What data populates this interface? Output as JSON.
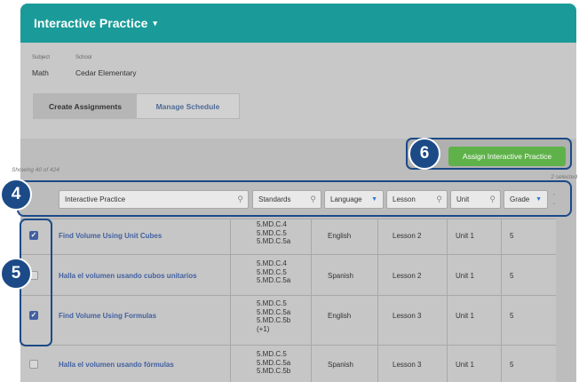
{
  "header": {
    "title": "Interactive Practice",
    "caret": "▾"
  },
  "meta": {
    "subject_label": "Subject",
    "subject_value": "Math",
    "school_label": "School",
    "school_value": "Cedar Elementary"
  },
  "tabs": [
    {
      "label": "Create Assignments",
      "active": true
    },
    {
      "label": "Manage Schedule",
      "active": false
    }
  ],
  "toolbar": {
    "showing": "Showing 40 of 424",
    "selected": "2 selected",
    "assign_label": "Assign Interactive Practice"
  },
  "filters": {
    "title_placeholder": "Interactive Practice",
    "standards": "Standards",
    "language": "Language",
    "lesson": "Lesson",
    "unit": "Unit",
    "grade": "Grade"
  },
  "callouts": {
    "four": "4",
    "five": "5",
    "six": "6"
  },
  "rows": [
    {
      "checked": true,
      "title": "Find Volume Using Unit Cubes",
      "standards": [
        "5.MD.C.4",
        "5.MD.C.5",
        "5.MD.C.5a"
      ],
      "language": "English",
      "lesson": "Lesson 2",
      "unit": "Unit 1",
      "grade": "5"
    },
    {
      "checked": false,
      "title": "Halla el volumen usando cubos unitarios",
      "standards": [
        "5.MD.C.4",
        "5.MD.C.5",
        "5.MD.C.5a"
      ],
      "language": "Spanish",
      "lesson": "Lesson 2",
      "unit": "Unit 1",
      "grade": "5"
    },
    {
      "checked": true,
      "title": "Find Volume Using Formulas",
      "standards": [
        "5.MD.C.5",
        "5.MD.C.5a",
        "5.MD.C.5b",
        "(+1)"
      ],
      "language": "English",
      "lesson": "Lesson 3",
      "unit": "Unit 1",
      "grade": "5"
    },
    {
      "checked": false,
      "title": "Halla el volumen usando fórmulas",
      "standards": [
        "5.MD.C.5",
        "5.MD.C.5a",
        "5.MD.C.5b"
      ],
      "language": "Spanish",
      "lesson": "Lesson 3",
      "unit": "Unit 1",
      "grade": "5"
    }
  ],
  "colors": {
    "header": "#1a9b99",
    "assign_button": "#5fb24a",
    "callout": "#1b4a87",
    "link": "#4361a1"
  }
}
